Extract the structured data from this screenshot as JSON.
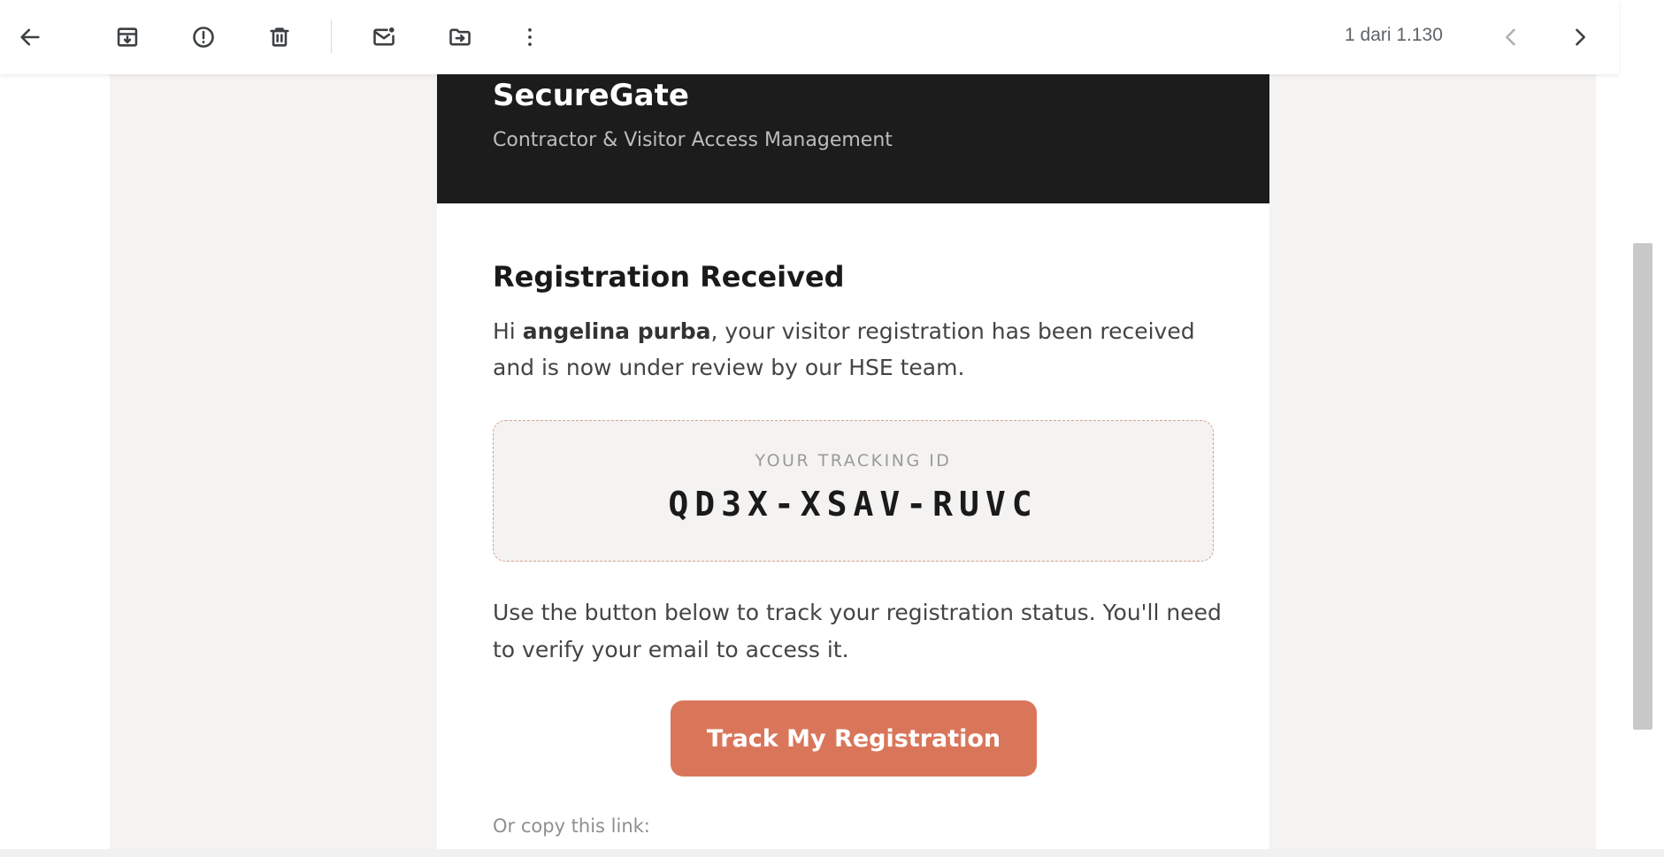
{
  "toolbar": {
    "back_icon": "arrow-left-icon",
    "archive_icon": "archive-icon",
    "spam_icon": "report-spam-icon",
    "delete_icon": "trash-icon",
    "mark_unread_icon": "mark-unread-icon",
    "move_icon": "move-to-folder-icon",
    "more_icon": "more-vertical-icon",
    "pager_text": "1 dari 1.130",
    "prev_icon": "chevron-left-icon",
    "next_icon": "chevron-right-icon"
  },
  "email": {
    "brand": "SecureGate",
    "tagline": "Contractor & Visitor Access Management",
    "heading": "Registration Received",
    "intro_prefix": "Hi ",
    "recipient_name": "angelina purba",
    "intro_suffix": ", your visitor registration has been received and is now under review by our HSE team.",
    "tracking_label": "YOUR TRACKING ID",
    "tracking_id": "QD3X-XSAV-RUVC",
    "instructions": "Use the button below to track your registration status. You'll need to verify your email to access it.",
    "button_label": "Track My Registration",
    "copy_link_label": "Or copy this link:"
  },
  "colors": {
    "banner": "#1c1c1c",
    "accent_button": "#d9765a",
    "tracking_border": "#d4a28c",
    "mail_background": "#f4f3f1"
  }
}
